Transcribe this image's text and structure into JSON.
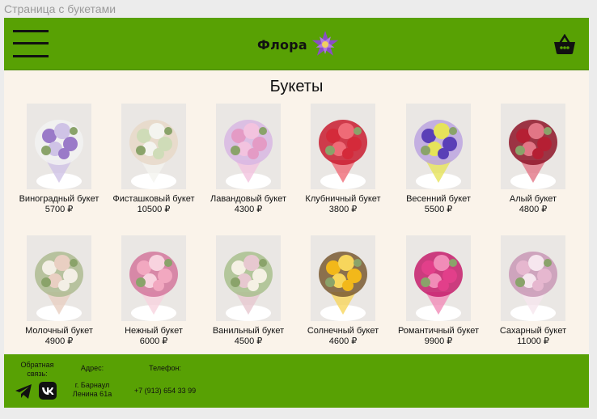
{
  "window": {
    "title": "Страница с букетами"
  },
  "header": {
    "logo_text": "Флора",
    "menu_icon": "hamburger-menu-icon",
    "cart_icon": "basket-icon"
  },
  "main": {
    "heading": "Букеты"
  },
  "products": [
    {
      "name": "Виноградный букет",
      "price": "5700 ₽",
      "colors": [
        "#9a7ac8",
        "#cfc3e6",
        "#f2f2f2"
      ]
    },
    {
      "name": "Фисташковый букет",
      "price": "10500 ₽",
      "colors": [
        "#cfdcb8",
        "#f4f4ef",
        "#e8d8c8"
      ]
    },
    {
      "name": "Лавандовый букет",
      "price": "4300 ₽",
      "colors": [
        "#e49bc5",
        "#f3c3df",
        "#d8b7e3"
      ]
    },
    {
      "name": "Клубничный букет",
      "price": "3800 ₽",
      "colors": [
        "#d42a3a",
        "#ef6b77",
        "#c91c30"
      ]
    },
    {
      "name": "Весенний букет",
      "price": "5500 ₽",
      "colors": [
        "#5a3fb7",
        "#e6e35a",
        "#bca5e0"
      ]
    },
    {
      "name": "Алый букет",
      "price": "4800 ₽",
      "colors": [
        "#b51f33",
        "#e27686",
        "#8e1428"
      ]
    },
    {
      "name": "Молочный букет",
      "price": "4900 ₽",
      "colors": [
        "#f3efe5",
        "#e9cfc2",
        "#aebb92"
      ]
    },
    {
      "name": "Нежный букет",
      "price": "6000 ₽",
      "colors": [
        "#f2a8c0",
        "#f8d3df",
        "#d3779c"
      ]
    },
    {
      "name": "Ванильный букет",
      "price": "4500 ₽",
      "colors": [
        "#f5f1e4",
        "#e7c8d0",
        "#a9c08e"
      ]
    },
    {
      "name": "Солнечный букет",
      "price": "4600 ₽",
      "colors": [
        "#f2b81a",
        "#f7d65c",
        "#7a5b32"
      ]
    },
    {
      "name": "Романтичный букет",
      "price": "9900 ₽",
      "colors": [
        "#e23f8a",
        "#f18cb8",
        "#c51d6c"
      ]
    },
    {
      "name": "Сахарный букет",
      "price": "11000 ₽",
      "colors": [
        "#e6b7cf",
        "#f6e6ee",
        "#c998b6"
      ]
    }
  ],
  "footer": {
    "feedback_label": "Обратная связь:",
    "address_label": "Адрес:",
    "address_value": "г. Барнаул Ленина 61а",
    "phone_label": "Телефон:",
    "phone_value": "+7 (913) 654 33 99",
    "social_icons": [
      "telegram-icon",
      "vk-icon"
    ]
  },
  "colors": {
    "header_bg": "#58a104",
    "main_bg": "#faf3ea",
    "logo_flower": "#8a4ec7"
  }
}
